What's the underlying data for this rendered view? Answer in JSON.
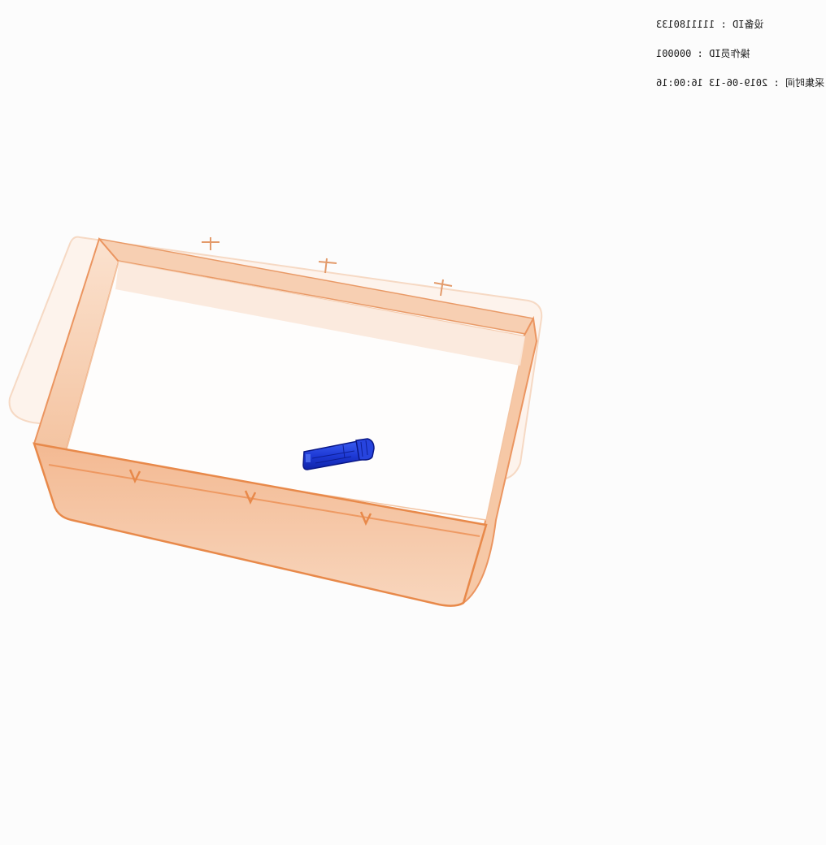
{
  "overlay": {
    "device_id_line": "设备ID : 1111180133",
    "operator_id_line": "操作员ID : 000001",
    "capture_time_line": "采集时间 : 2019-06-13 16:00:16"
  },
  "scene": {
    "objects": [
      "tray",
      "lighter"
    ],
    "colors": {
      "background": "#fcfcfc",
      "tray_edge": "#e8894a",
      "tray_fill": "#f6c9a8",
      "tray_light": "#fbe4d3",
      "object_blue": "#1e3ad6",
      "object_dark_blue": "#0c1d9a"
    }
  }
}
